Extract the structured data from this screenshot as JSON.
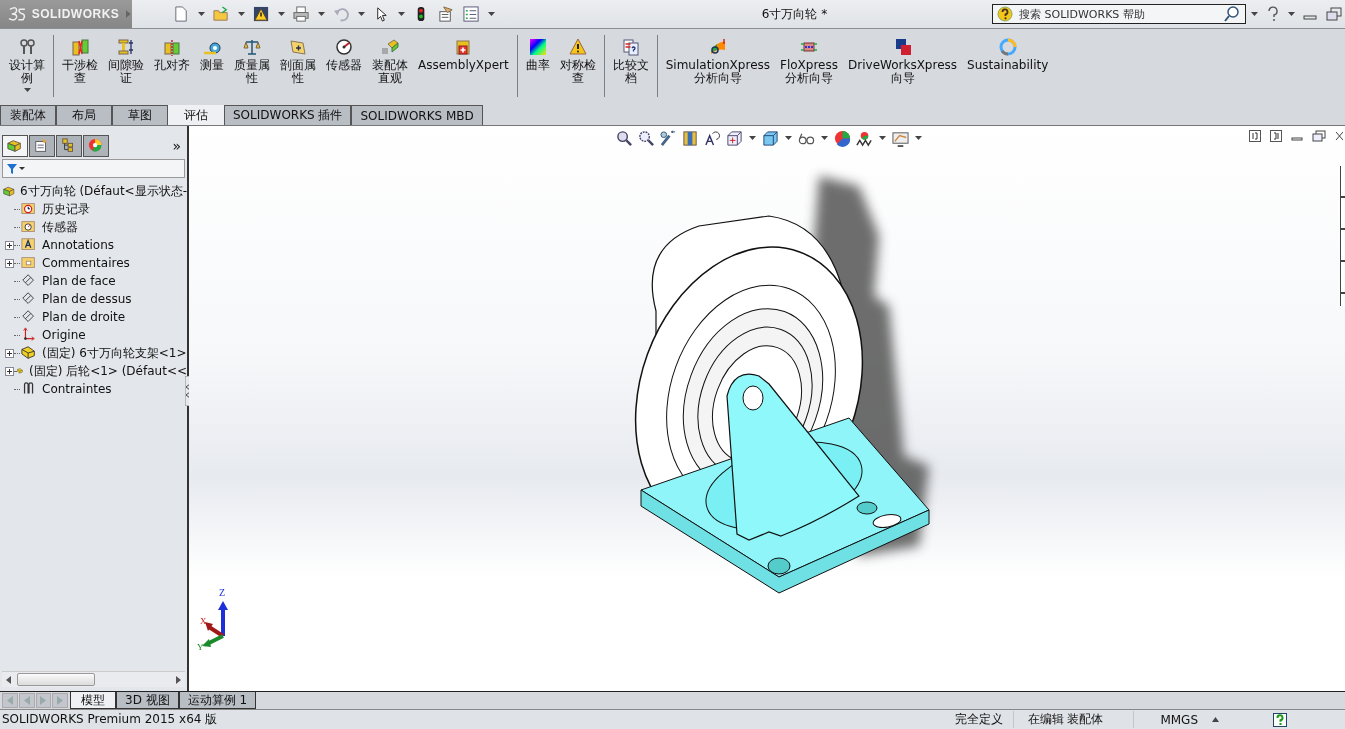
{
  "app": {
    "logo": "SOLIDWORKS",
    "title": "6寸万向轮 *",
    "help_search": {
      "placeholder": "搜索 SOLIDWORKS 帮助"
    }
  },
  "ribbon": {
    "groups": [
      {
        "items": [
          {
            "lines": [
              "设计算",
              "例"
            ],
            "dropdown": true
          }
        ]
      },
      {
        "items": [
          {
            "lines": [
              "干涉检",
              "查"
            ],
            "dropdown": false
          },
          {
            "lines": [
              "间隙验",
              "证"
            ],
            "dropdown": false
          },
          {
            "lines": [
              "孔对齐"
            ],
            "dropdown": false
          },
          {
            "lines": [
              "测量"
            ],
            "dropdown": false
          },
          {
            "lines": [
              "质量属",
              "性"
            ],
            "dropdown": false
          },
          {
            "lines": [
              "剖面属",
              "性"
            ],
            "dropdown": false
          },
          {
            "lines": [
              "传感器"
            ],
            "dropdown": false
          },
          {
            "lines": [
              "装配体",
              "直观"
            ],
            "dropdown": false
          },
          {
            "lines": [
              "AssemblyXpert"
            ],
            "dropdown": false
          }
        ]
      },
      {
        "items": [
          {
            "lines": [
              "曲率"
            ],
            "dropdown": false
          },
          {
            "lines": [
              "对称检",
              "查"
            ],
            "dropdown": false
          }
        ]
      },
      {
        "items": [
          {
            "lines": [
              "比较文",
              "档"
            ],
            "dropdown": false
          }
        ]
      },
      {
        "items": [
          {
            "lines": [
              "SimulationXpress",
              "分析向导"
            ],
            "dropdown": false
          },
          {
            "lines": [
              "FloXpress",
              "分析向导"
            ],
            "dropdown": false
          },
          {
            "lines": [
              "DriveWorksXpress",
              "向导"
            ],
            "dropdown": false
          },
          {
            "lines": [
              "Sustainability"
            ],
            "dropdown": false
          }
        ]
      }
    ]
  },
  "tabs": [
    {
      "label": "装配体",
      "selected": false
    },
    {
      "label": "布局",
      "selected": false
    },
    {
      "label": "草图",
      "selected": false
    },
    {
      "label": "评估",
      "selected": true
    },
    {
      "label": "SOLIDWORKS 插件",
      "selected": false
    },
    {
      "label": "SOLIDWORKS MBD",
      "selected": false
    }
  ],
  "panel": {
    "tabs": [
      {
        "selected": true
      },
      {
        "selected": false
      },
      {
        "selected": false
      },
      {
        "selected": false
      }
    ],
    "more": "»"
  },
  "tree": {
    "root": {
      "label": "6寸万向轮  (Défaut<显示状态-",
      "kind": "assembly"
    },
    "children": [
      {
        "label": "历史记录",
        "kind": "history",
        "expandable": false
      },
      {
        "label": "传感器",
        "kind": "sensors",
        "expandable": false
      },
      {
        "label": "Annotations",
        "kind": "annotations",
        "expandable": true
      },
      {
        "label": "Commentaires",
        "kind": "folder",
        "expandable": true
      },
      {
        "label": "Plan de face",
        "kind": "plane",
        "expandable": false
      },
      {
        "label": "Plan de dessus",
        "kind": "plane",
        "expandable": false
      },
      {
        "label": "Plan de droite",
        "kind": "plane",
        "expandable": false
      },
      {
        "label": "Origine",
        "kind": "origin",
        "expandable": false
      },
      {
        "label": "(固定) 6寸万向轮支架<1>",
        "kind": "part",
        "expandable": true
      },
      {
        "label": "(固定) 后轮<1> (Défaut<<",
        "kind": "part",
        "expandable": true
      },
      {
        "label": "Contraintes",
        "kind": "mates",
        "expandable": false
      }
    ]
  },
  "triad": {
    "x": "X",
    "y": "Y",
    "z": "Z"
  },
  "bottom_tabs": [
    {
      "label": "模型",
      "selected": true
    },
    {
      "label": "3D 视图",
      "selected": false
    },
    {
      "label": "运动算例 1",
      "selected": false
    }
  ],
  "status_bar": {
    "product": "SOLIDWORKS Premium 2015 x64 版",
    "definition": "完全定义",
    "editing": "在编辑 装配体",
    "units": "MMGS"
  }
}
